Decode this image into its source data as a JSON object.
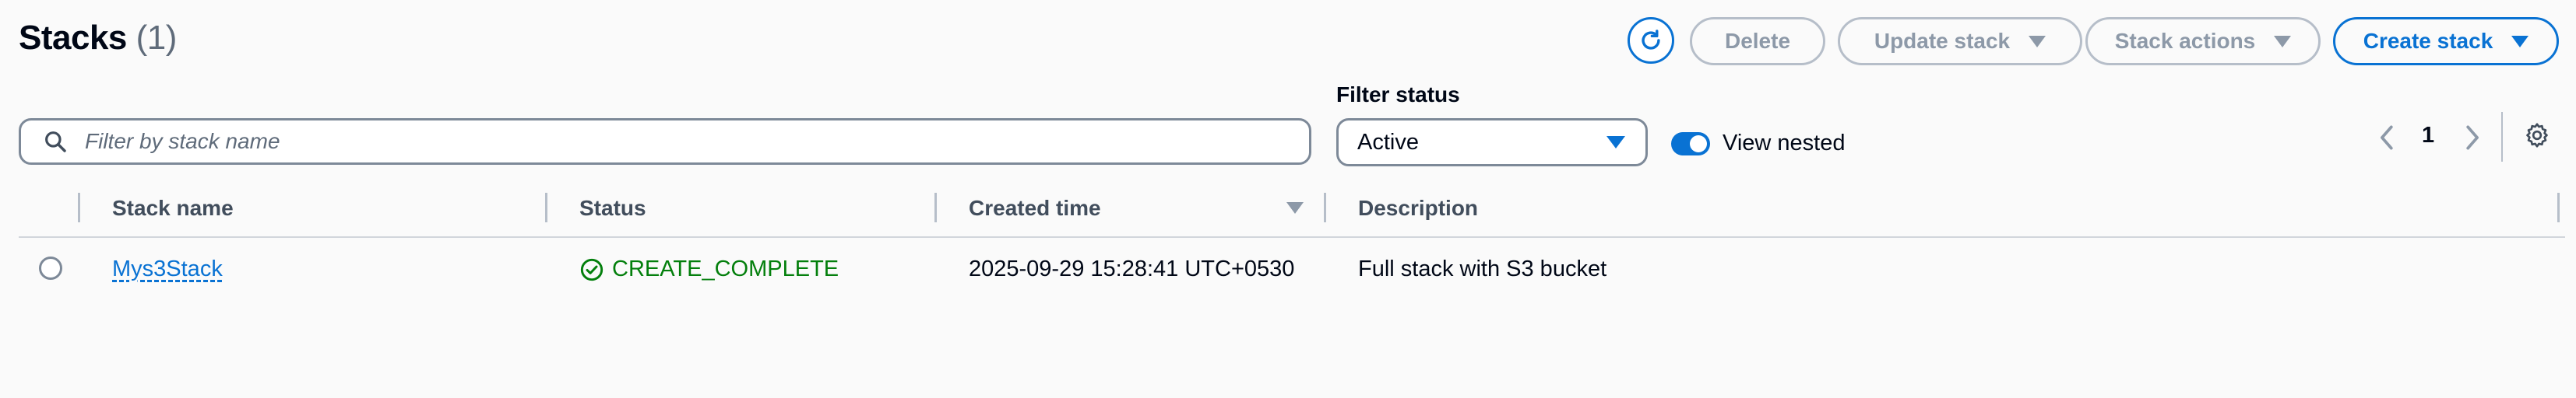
{
  "header": {
    "title": "Stacks",
    "count": "(1)"
  },
  "toolbar": {
    "delete_label": "Delete",
    "update_label": "Update stack",
    "actions_label": "Stack actions",
    "create_label": "Create stack"
  },
  "filters": {
    "search_placeholder": "Filter by stack name",
    "search_value": "",
    "status_label": "Filter status",
    "status_value": "Active",
    "view_nested_label": "View nested",
    "view_nested_on": true
  },
  "pagination": {
    "current_page": "1"
  },
  "table": {
    "columns": [
      "Stack name",
      "Status",
      "Created time",
      "Description"
    ],
    "rows": [
      {
        "name": "Mys3Stack",
        "status": "CREATE_COMPLETE",
        "created": "2025-09-29 15:28:41 UTC+0530",
        "description": "Full stack with S3 bucket"
      }
    ]
  },
  "colors": {
    "accent": "#0972d3",
    "success": "#037f0c",
    "disabled": "#8d99a8",
    "border": "#7d8998"
  },
  "icons": {
    "refresh": "refresh-icon",
    "search": "search-icon",
    "settings": "gear-icon",
    "status_ok": "check-circle-icon"
  }
}
